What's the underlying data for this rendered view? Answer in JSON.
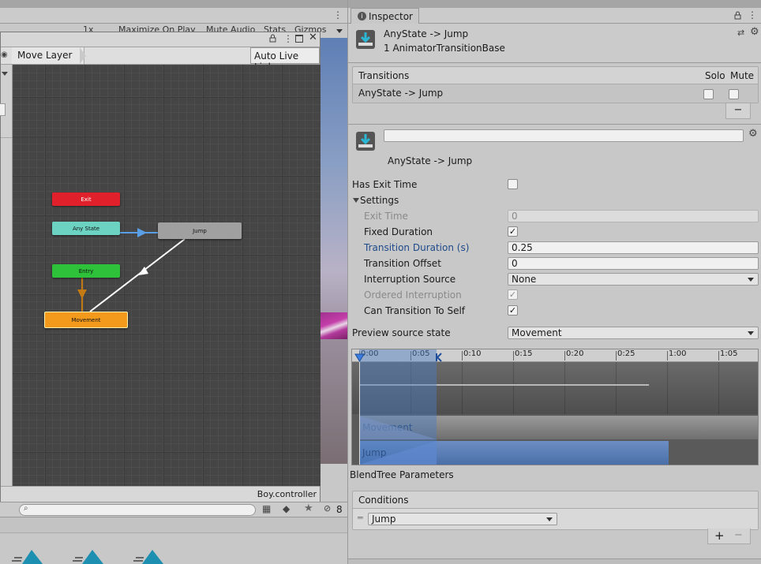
{
  "game_view": {
    "scale_value": "1x",
    "options": [
      "Maximize On Play",
      "Mute Audio",
      "Stats",
      "Gizmos"
    ]
  },
  "animator": {
    "layer_breadcrumb": "Move Layer",
    "auto_live_link": "Auto Live Link",
    "status_file": "Boy.controller",
    "nodes": {
      "exit": "Exit",
      "any_state": "Any State",
      "jump": "Jump",
      "entry": "Entry",
      "movement": "Movement"
    }
  },
  "project": {
    "search_placeholder": "",
    "hidden_count": "8"
  },
  "inspector": {
    "tab_label": "Inspector",
    "header_title": "AnyState -> Jump",
    "header_subtitle": "1 AnimatorTransitionBase",
    "transitions": {
      "header": "Transitions",
      "solo": "Solo",
      "mute": "Mute",
      "row": "AnyState -> Jump",
      "remove": "−"
    },
    "transition_name_value": "",
    "transition_title": "AnyState -> Jump",
    "has_exit_time": {
      "label": "Has Exit Time",
      "checked": false
    },
    "settings_label": "Settings",
    "settings": {
      "exit_time": {
        "label": "Exit Time",
        "value": "0"
      },
      "fixed_duration": {
        "label": "Fixed Duration",
        "checked": true
      },
      "transition_duration": {
        "label": "Transition Duration (s)",
        "value": "0.25"
      },
      "transition_offset": {
        "label": "Transition Offset",
        "value": "0"
      },
      "interruption_source": {
        "label": "Interruption Source",
        "value": "None"
      },
      "ordered_interruption": {
        "label": "Ordered Interruption",
        "checked": true
      },
      "can_transition_to_self": {
        "label": "Can Transition To Self",
        "checked": true
      }
    },
    "preview_source_state": {
      "label": "Preview source state",
      "value": "Movement"
    },
    "timeline": {
      "ticks": [
        "0:00",
        "0:05",
        "0:10",
        "0:15",
        "0:20",
        "0:25",
        "1:00",
        "1:05"
      ],
      "track_source": "Movement",
      "track_dest": "Jump"
    },
    "blendtree_label": "BlendTree Parameters",
    "conditions": {
      "header": "Conditions",
      "parameter": "Jump",
      "add": "+",
      "remove": "−"
    }
  },
  "colors": {
    "exit_node": "#e0212b",
    "any_state_node": "#6cd3c2",
    "jump_node": "#a0a0a0",
    "entry_node": "#2dc23a",
    "movement_node": "#f39a1d",
    "timeline_selection": "#4a7cc4",
    "duration_label": "#1f4a8a"
  },
  "checkmark_glyph": "✓"
}
